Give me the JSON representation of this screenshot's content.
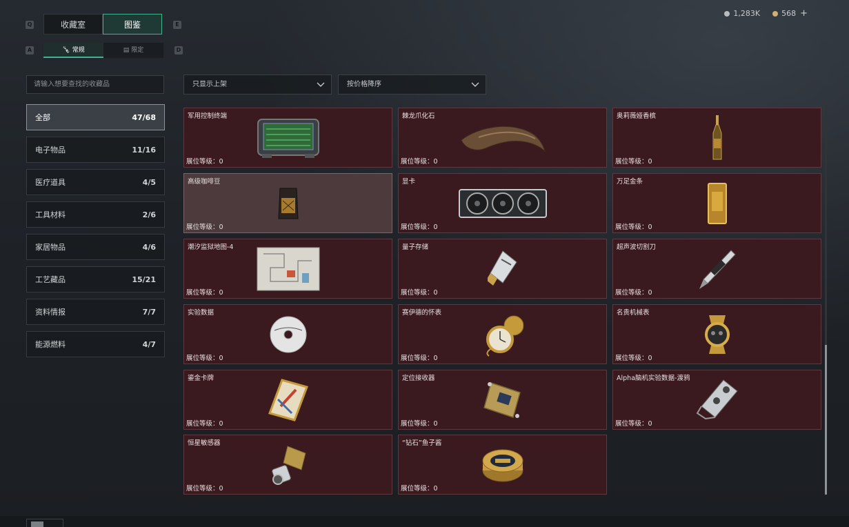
{
  "top_tabs": [
    {
      "label": "收藏室",
      "active": false
    },
    {
      "label": "图鉴",
      "active": true
    }
  ],
  "key_hints": {
    "prev_tab": "Q",
    "next_tab": "E",
    "prev_sub": "A",
    "next_sub": "D"
  },
  "sub_tabs": [
    {
      "label": "常规",
      "icon": "bottle-icon",
      "active": true
    },
    {
      "label": "限定",
      "icon": "crate-icon",
      "active": false
    }
  ],
  "currency": {
    "silver": "1,283K",
    "gold": "568",
    "add": "+"
  },
  "search": {
    "placeholder": "请输入想要查找的收藏品"
  },
  "filters": {
    "shelf": "只显示上架",
    "sort": "按价格降序"
  },
  "categories": [
    {
      "label": "全部",
      "count": "47/68",
      "active": true
    },
    {
      "label": "电子物品",
      "count": "11/16"
    },
    {
      "label": "医疗道具",
      "count": "4/5"
    },
    {
      "label": "工具材料",
      "count": "2/6"
    },
    {
      "label": "家居物品",
      "count": "4/6"
    },
    {
      "label": "工艺藏品",
      "count": "15/21"
    },
    {
      "label": "资料情报",
      "count": "7/7"
    },
    {
      "label": "能源燃料",
      "count": "4/7"
    }
  ],
  "items": [
    {
      "name": "军用控制终端",
      "level": "展位等级：0",
      "icon": "control-terminal-icon"
    },
    {
      "name": "棘龙爪化石",
      "level": "展位等级：0",
      "icon": "claw-fossil-icon"
    },
    {
      "name": "奥莉薇娅香槟",
      "level": "展位等级：0",
      "icon": "champagne-icon"
    },
    {
      "name": "高级咖啡豆",
      "level": "展位等级：0",
      "icon": "coffee-bag-icon",
      "highlighted": true
    },
    {
      "name": "显卡",
      "level": "展位等级：0",
      "icon": "graphics-card-icon"
    },
    {
      "name": "万足金条",
      "level": "展位等级：0",
      "icon": "gold-bar-icon"
    },
    {
      "name": "潮汐监狱地图-4",
      "level": "展位等级：0",
      "icon": "map-icon"
    },
    {
      "name": "量子存储",
      "level": "展位等级：0",
      "icon": "usb-drive-icon"
    },
    {
      "name": "超声波切割刀",
      "level": "展位等级：0",
      "icon": "cutter-pen-icon"
    },
    {
      "name": "实验数据",
      "level": "展位等级：0",
      "icon": "disc-icon"
    },
    {
      "name": "赛伊德的怀表",
      "level": "展位等级：0",
      "icon": "pocket-watch-icon"
    },
    {
      "name": "名贵机械表",
      "level": "展位等级：0",
      "icon": "wristwatch-icon"
    },
    {
      "name": "鎏金卡牌",
      "level": "展位等级：0",
      "icon": "gold-card-icon"
    },
    {
      "name": "定位接收器",
      "level": "展位等级：0",
      "icon": "gps-receiver-icon"
    },
    {
      "name": "Alpha脑机实验数据-渡鸦",
      "level": "展位等级：0",
      "icon": "brain-chip-icon"
    },
    {
      "name": "恒星敏感器",
      "level": "展位等级：0",
      "icon": "star-sensor-icon"
    },
    {
      "name": "“钻石”鱼子酱",
      "level": "展位等级：0",
      "icon": "caviar-tin-icon"
    }
  ]
}
